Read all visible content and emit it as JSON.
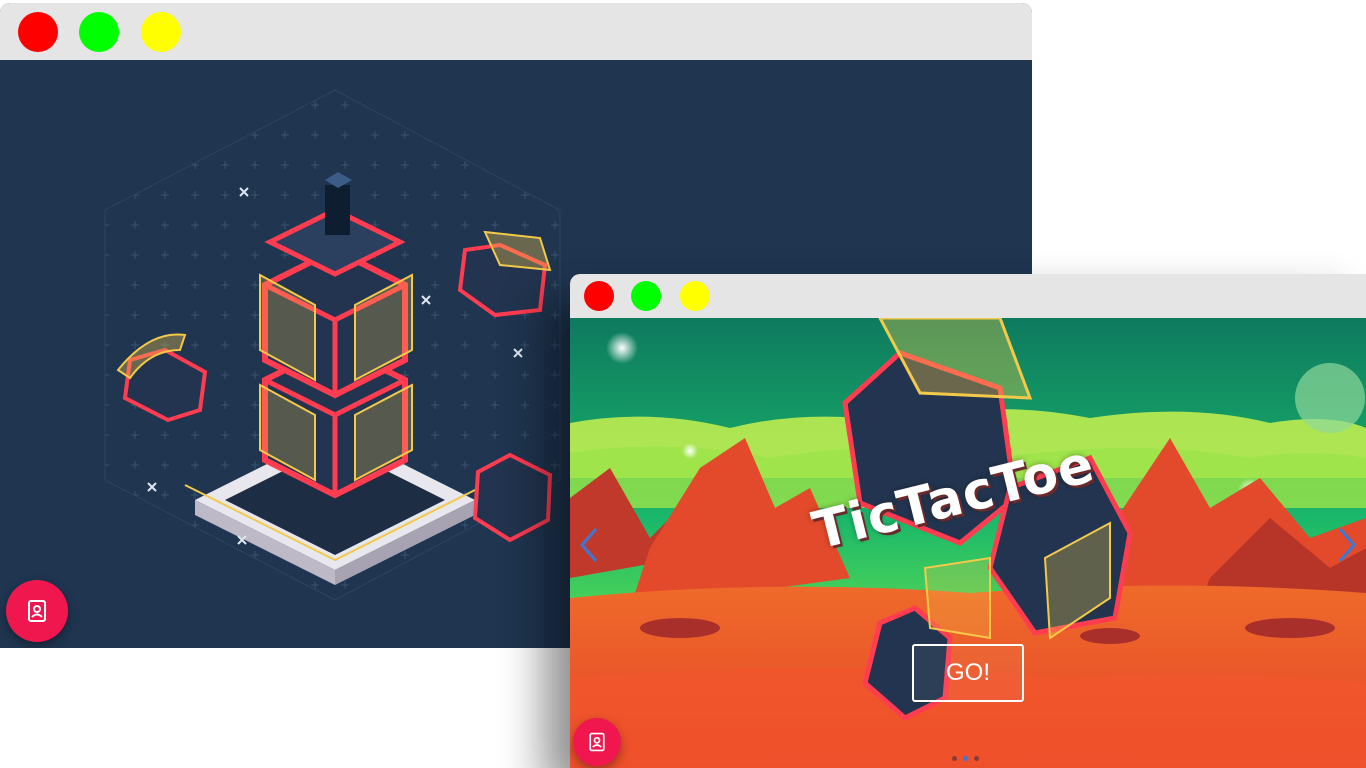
{
  "back_window": {
    "controls": {
      "close_color": "#ff0000",
      "minimize_color": "#00ff00",
      "maximize_color": "#ffff00"
    },
    "fab_icon": "profile-card-icon"
  },
  "front_window": {
    "controls": {
      "close_color": "#ff0000",
      "minimize_color": "#00ff00",
      "maximize_color": "#ffff00"
    },
    "game_title": "TicTacToe",
    "go_button_label": "GO!",
    "prev_icon": "chevron-left-icon",
    "next_icon": "chevron-right-icon",
    "fab_icon": "profile-card-icon",
    "carousel": {
      "page_count": 3,
      "active_index": 1
    }
  },
  "colors": {
    "navy_bg": "#1f3550",
    "accent_red": "#f0174f",
    "cube_outline": "#ff3c50",
    "glass_yellow": "#f3c94a"
  }
}
